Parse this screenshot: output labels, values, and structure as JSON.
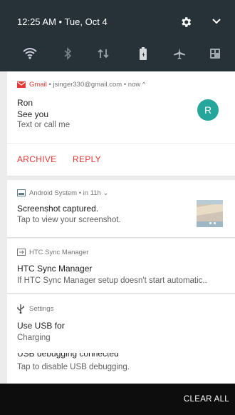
{
  "status": {
    "time_date": "12:25 AM • Tue, Oct 4"
  },
  "quick_settings": [
    "wifi-icon",
    "bluetooth-icon",
    "data-icon",
    "battery-saver-icon",
    "airplane-icon",
    "settings-grid-icon"
  ],
  "gmail": {
    "header": "Gmail • jsinger330@gmail.com • now ‸",
    "sender": "Ron",
    "subject": "See you",
    "text": "Text or call me",
    "avatar_letter": "R",
    "archive": "ARCHIVE",
    "reply": "REPLY",
    "avatar_color": "#26a69a",
    "accent": "#e53935"
  },
  "android": {
    "header": "Android System • in 11h ⌄",
    "title": "Screenshot captured.",
    "text": "Tap to view your screenshot."
  },
  "htc": {
    "header": "HTC Sync Manager",
    "title": "HTC Sync Manager",
    "text": "If HTC Sync Manager setup doesn't start automatic.."
  },
  "settings": {
    "header": "Settings",
    "title": "Use USB for",
    "text": "Charging"
  },
  "usb_debug": {
    "title_partial": "USB debugging connected",
    "text": "Tap to disable USB debugging."
  },
  "clear_all": "CLEAR ALL"
}
